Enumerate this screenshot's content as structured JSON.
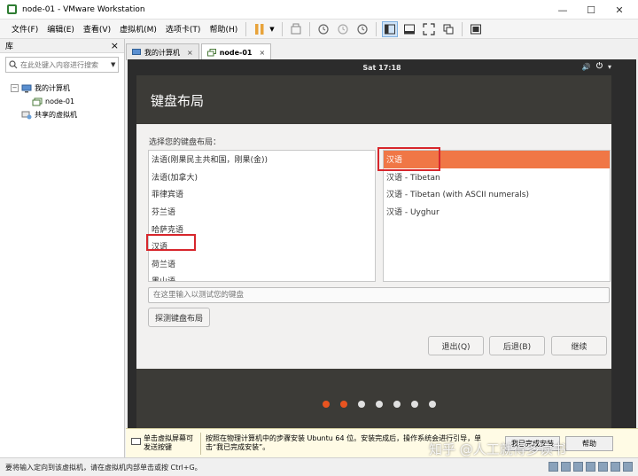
{
  "window": {
    "title": "node-01 - VMware Workstation",
    "minimize": "—",
    "maximize": "☐",
    "close": "✕"
  },
  "menu": [
    "文件(F)",
    "编辑(E)",
    "查看(V)",
    "虚拟机(M)",
    "选项卡(T)",
    "帮助(H)"
  ],
  "library": {
    "title": "库",
    "close": "×",
    "search_placeholder": "在此处键入内容进行搜索",
    "tree": {
      "my_computer": "我的计算机",
      "node": "node-01",
      "shared": "共享的虚拟机"
    }
  },
  "tabs": [
    {
      "label": "我的计算机",
      "close": "×"
    },
    {
      "label": "node-01",
      "close": "×"
    }
  ],
  "vm_topbar": {
    "time": "Sat 17:18",
    "volume": "🔊",
    "power": "⏻",
    "menu": "▾"
  },
  "installer": {
    "title": "键盘布局",
    "choose_label": "选择您的键盘布局：",
    "left_list": [
      "法语(刚果民主共和国，刚果(金))",
      "法语(加拿大)",
      "菲律宾语",
      "芬兰语",
      "哈萨克语",
      "汉语",
      "荷兰语",
      "黑山语"
    ],
    "right_list": [
      "汉语",
      "汉语 - Tibetan",
      "汉语 - Tibetan (with ASCII numerals)",
      "汉语 - Uyghur"
    ],
    "test_placeholder": "在这里输入以测试您的键盘",
    "detect_button": "探测键盘布局",
    "quit_button": "退出(Q)",
    "back_button": "后退(B)",
    "continue_button": "继续",
    "progress": {
      "total_steps": 7,
      "completed_steps": 2
    }
  },
  "hint": {
    "left": "单击虚拟屏幕可发送按键",
    "main": "按照在物理计算机中的步骤安装 Ubuntu 64 位。安装完成后，操作系统会进行引导，单击“我已完成安装”。",
    "done_button": "我已完成安装",
    "help_button": "帮助"
  },
  "statusbar": {
    "text": "要将输入定向到该虚拟机，请在虚拟机内部单击或按 Ctrl+G。"
  },
  "watermark": "知乎 @人工就得多读书"
}
